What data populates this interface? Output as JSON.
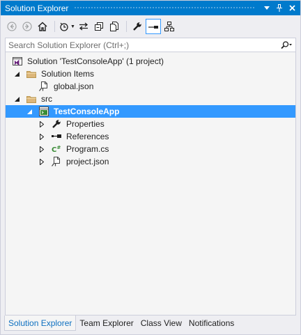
{
  "window": {
    "title": "Solution Explorer",
    "accent": "#007ACC",
    "selection_color": "#3399FF"
  },
  "title_buttons": [
    "dropdown-arrow-icon",
    "pin-icon",
    "close-icon"
  ],
  "toolbar": {
    "buttons": [
      "back-icon",
      "forward-icon",
      "home-icon",
      "pending-changes-filter-icon",
      "sync-icon",
      "collapse-all-icon",
      "show-all-files-icon",
      "properties-icon",
      "preview-selected-icon",
      "class-diagram-icon"
    ]
  },
  "search": {
    "placeholder": "Search Solution Explorer (Ctrl+;)",
    "value": ""
  },
  "tree": {
    "items": [
      {
        "label": "Solution 'TestConsoleApp' (1 project)",
        "icon": "solution-icon",
        "level": 0,
        "expander": "none",
        "selected": false
      },
      {
        "label": "Solution Items",
        "icon": "folder-icon",
        "level": 1,
        "expander": "expanded",
        "selected": false
      },
      {
        "label": "global.json",
        "icon": "json-file-icon",
        "level": 2,
        "expander": "none",
        "selected": false
      },
      {
        "label": "src",
        "icon": "folder-icon",
        "level": 1,
        "expander": "expanded",
        "selected": false
      },
      {
        "label": "TestConsoleApp",
        "icon": "project-icon",
        "level": 2,
        "expander": "expanded",
        "selected": true
      },
      {
        "label": "Properties",
        "icon": "wrench-icon",
        "level": 3,
        "expander": "collapsed",
        "selected": false
      },
      {
        "label": "References",
        "icon": "references-icon",
        "level": 3,
        "expander": "collapsed",
        "selected": false
      },
      {
        "label": "Program.cs",
        "icon": "csharp-file-icon",
        "level": 3,
        "expander": "collapsed",
        "selected": false
      },
      {
        "label": "project.json",
        "icon": "json-file-icon",
        "level": 3,
        "expander": "collapsed",
        "selected": false
      }
    ]
  },
  "tabs": [
    {
      "label": "Solution Explorer",
      "active": true
    },
    {
      "label": "Team Explorer",
      "active": false
    },
    {
      "label": "Class View",
      "active": false
    },
    {
      "label": "Notifications",
      "active": false
    }
  ]
}
